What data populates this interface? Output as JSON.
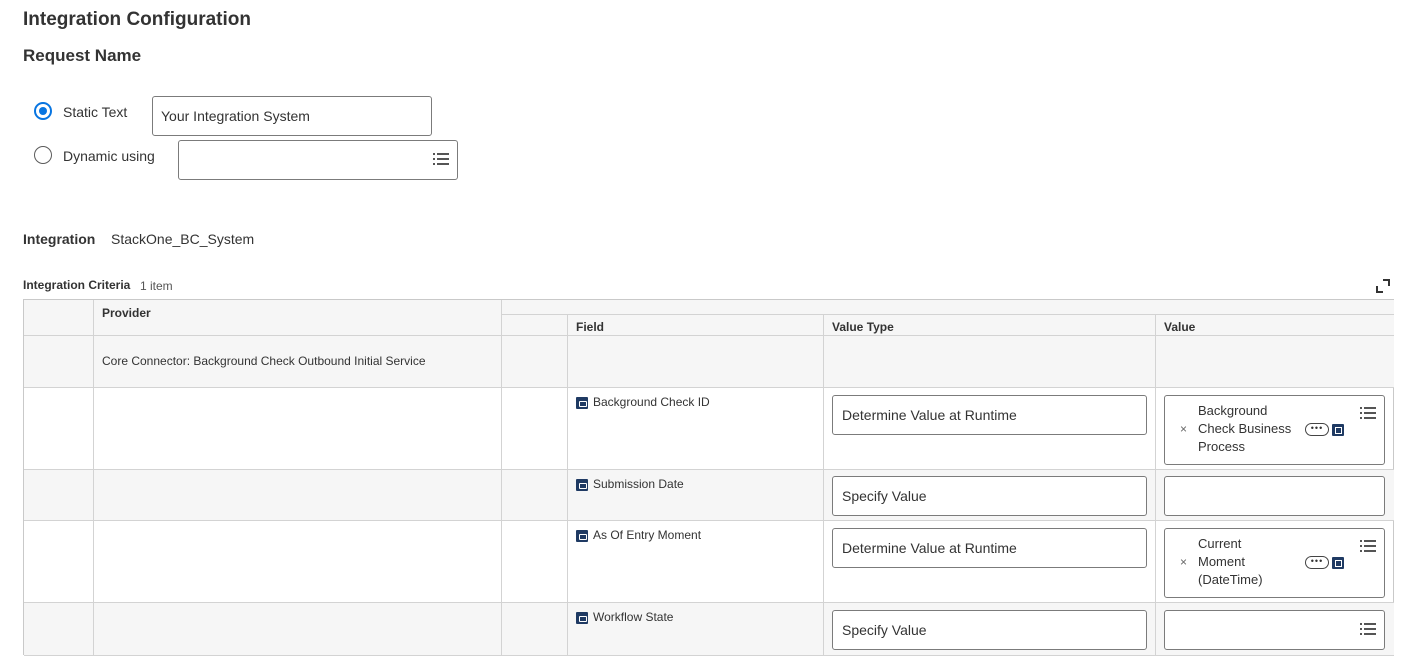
{
  "page": {
    "title": "Integration Configuration"
  },
  "request_name": {
    "title": "Request Name",
    "static_option_label": "Static Text",
    "static_value": "Your Integration System",
    "dynamic_option_label": "Dynamic using",
    "dynamic_value": ""
  },
  "integration": {
    "label": "Integration",
    "value": "StackOne_BC_System"
  },
  "criteria": {
    "label": "Integration Criteria",
    "count": "1 item",
    "columns": {
      "provider": "Provider",
      "field": "Field",
      "value_type": "Value Type",
      "value": "Value"
    },
    "provider_value": "Core Connector: Background Check Outbound Initial Service",
    "rows": [
      {
        "field": "Background Check ID",
        "value_type": "Determine Value at Runtime",
        "value_lines": [
          "Background",
          "Check Business",
          "Process"
        ]
      },
      {
        "field": "Submission Date",
        "value_type": "Specify Value",
        "value_lines": []
      },
      {
        "field": "As Of Entry Moment",
        "value_type": "Determine Value at Runtime",
        "value_lines": [
          "Current",
          "Moment",
          "(DateTime)"
        ]
      },
      {
        "field": "Workflow State",
        "value_type": "Specify Value",
        "value_lines": []
      }
    ],
    "remove_symbol": "×",
    "more_symbol": "•••"
  },
  "colors": {
    "accent": "#0875e1",
    "icon_navy": "#1f3a63",
    "header_bg": "#f6f6f6"
  }
}
